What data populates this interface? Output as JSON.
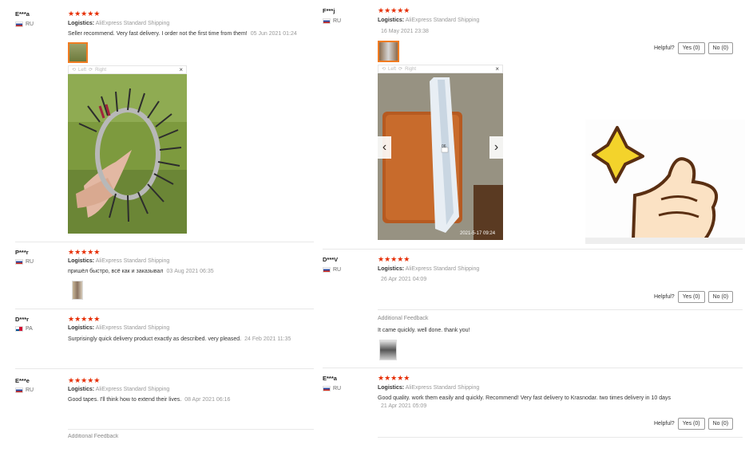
{
  "left_reviews": [
    {
      "name": "E***a",
      "country": "RU",
      "logistics_label": "Logistics:",
      "logistics": "AliExpress Standard Shipping",
      "text": "Seller recommend. Very fast delivery. I order not the first time from them!",
      "date": "05 Jun 2021 01:24"
    },
    {
      "name": "P***r",
      "country": "RU",
      "logistics_label": "Logistics:",
      "logistics": "AliExpress Standard Shipping",
      "text": "пришёл быстро, всё как и заказывал",
      "date": "03 Aug 2021 06:35"
    },
    {
      "name": "D***r",
      "country": "PA",
      "logistics_label": "Logistics:",
      "logistics": "AliExpress Standard Shipping",
      "text": "Surprisingly quick delivery product exactly as described. very pleased.",
      "date": "24 Feb 2021 11:35"
    },
    {
      "name": "E***e",
      "country": "RU",
      "logistics_label": "Logistics:",
      "logistics": "AliExpress Standard Shipping",
      "text": "Good tapes. I'll think how to extend their lives.",
      "date": "08 Apr 2021 06:16"
    }
  ],
  "left_additional_feedback": "Additional Feedback",
  "right_reviews": [
    {
      "name": "F***j",
      "country": "RU",
      "logistics_label": "Logistics:",
      "logistics": "AliExpress Standard Shipping",
      "date": "16 May 2021 23:38"
    },
    {
      "name": "D***V",
      "country": "RU",
      "logistics_label": "Logistics:",
      "logistics": "AliExpress Standard Shipping",
      "date": "26 Apr 2021 04:09"
    },
    {
      "name": "E***a",
      "country": "RU",
      "logistics_label": "Logistics:",
      "logistics": "AliExpress Standard Shipping",
      "text": "Good quality. work them easily and quickly. Recommend! Very fast delivery to Krasnodar. two times delivery in 10 days",
      "date": "21 Apr 2021 05:09"
    }
  ],
  "right_additional_feedback": {
    "label": "Additional Feedback",
    "text": "It came quickly. well done. thank you!"
  },
  "viewer": {
    "left": "Left",
    "right": "Right",
    "close": "×"
  },
  "photo_timestamp": "2021-5-17 09:24",
  "photo_box_label": "06",
  "stars": "★★★★★",
  "helpful": {
    "label": "Helpful?",
    "yes": "Yes (0)",
    "no": "No (0)"
  },
  "icons": {
    "rotate_left": "rotate-left-icon",
    "rotate_right": "rotate-right-icon",
    "prev": "chevron-left-icon",
    "next": "chevron-right-icon"
  },
  "colors": {
    "star": "#e62e04",
    "active_thumb": "#f07c22"
  }
}
